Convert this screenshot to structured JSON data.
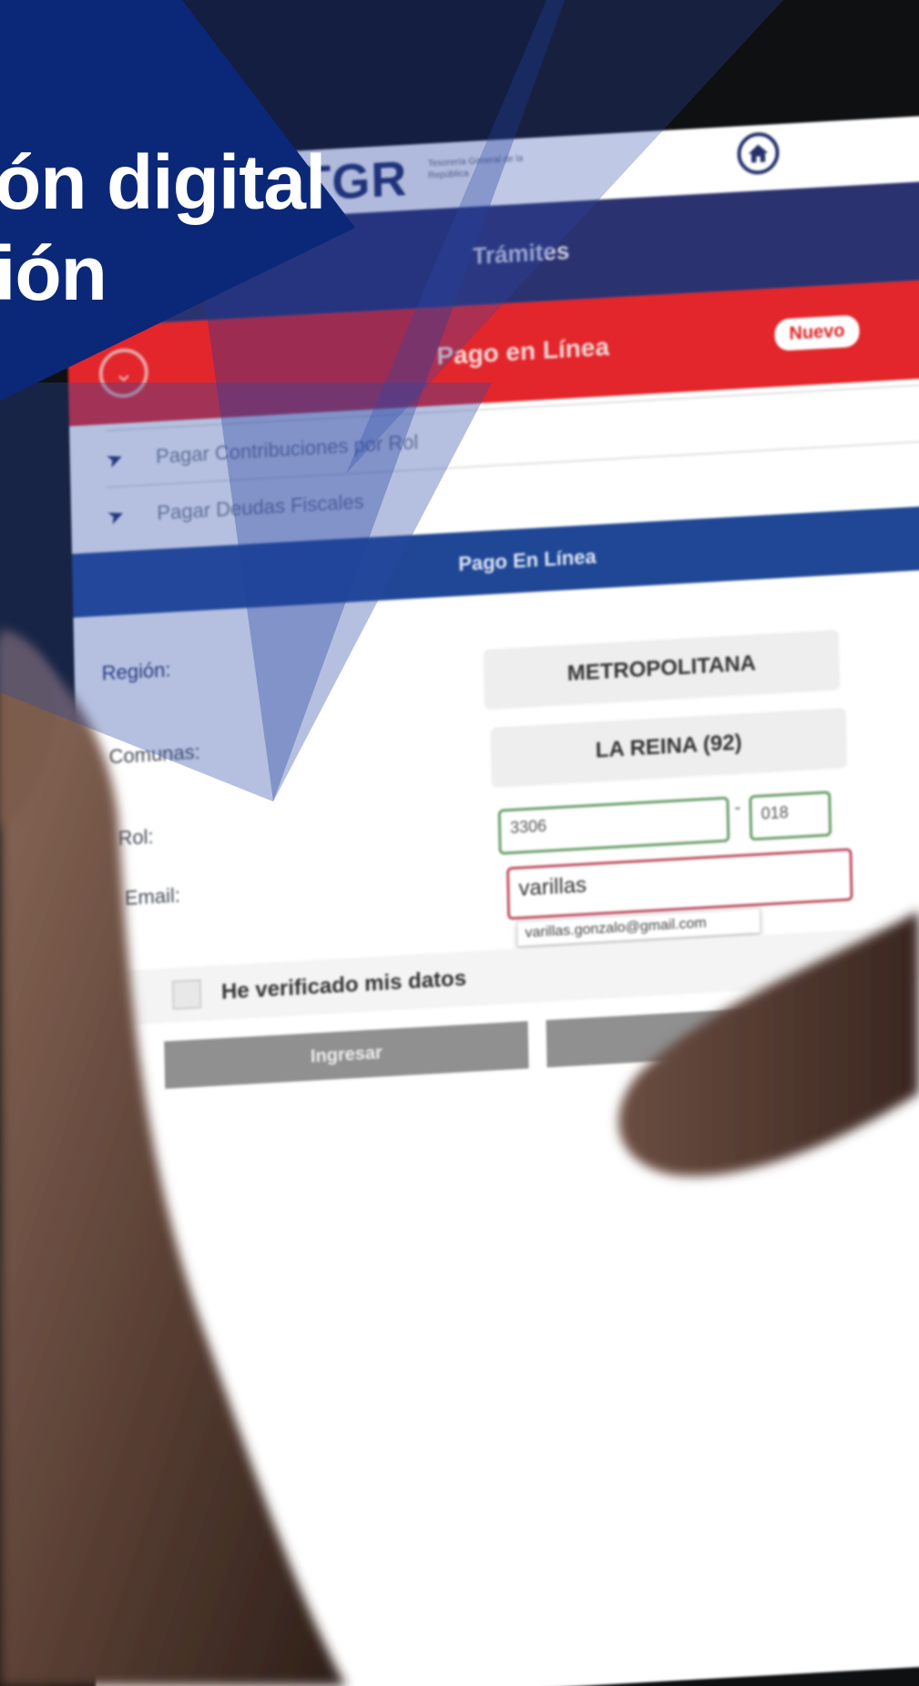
{
  "headline": {
    "line1": "ón digital",
    "line2": "ión"
  },
  "app": {
    "logo": "TGR",
    "logo_subtitle": "Tesorería General de la República",
    "tramites": "Trámites",
    "pago_bar": "Pago en Línea",
    "nuevo_badge": "Nuevo",
    "menu": [
      {
        "label": "Pagar Contribuciones por Rol"
      },
      {
        "label": "Pagar Deudas Fiscales"
      }
    ],
    "section_title": "Pago En Línea",
    "form": {
      "region_label": "Región:",
      "region_value": "METROPOLITANA",
      "comunas_label": "Comunas:",
      "comunas_value": "LA REINA (92)",
      "rol_label": "Rol:",
      "rol_value_1": "3306",
      "rol_value_2": "018",
      "email_label": "Email:",
      "email_value": "varillas",
      "email_suggestion": "varillas.gonzalo@gmail.com",
      "verify_label": "He verificado mis datos",
      "submit_label": "Ingresar"
    }
  },
  "colors": {
    "navy_overlay": "#0b2778",
    "tramites_bar": "#2b3270",
    "pago_bar_red": "#e2262b",
    "section_blue": "#1f4795"
  }
}
